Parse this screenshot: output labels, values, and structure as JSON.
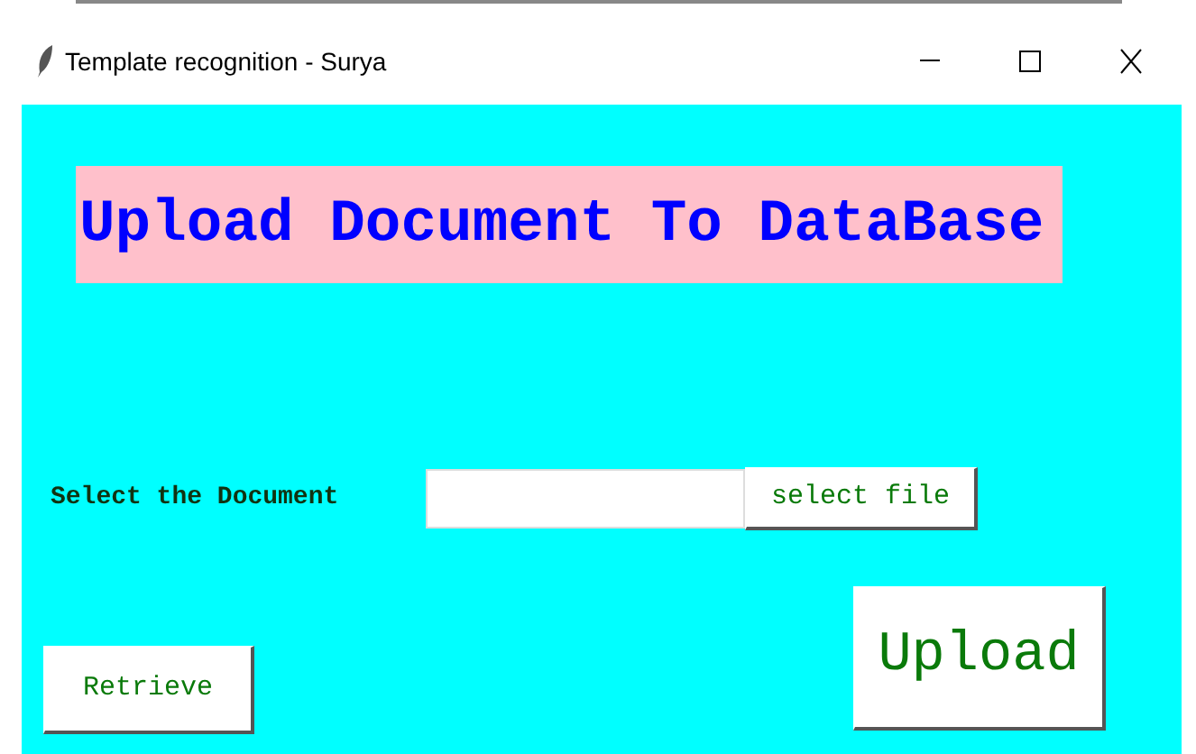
{
  "window": {
    "title": "Template recognition - Surya"
  },
  "heading": "Upload Document To DataBase",
  "document_field": {
    "label": "Select the Document"
  },
  "buttons": [
    {
      "kind": "select",
      "label": "select file"
    },
    {
      "kind": "retrieve",
      "label": "Retrieve"
    },
    {
      "kind": "upload",
      "label": "Upload"
    }
  ]
}
